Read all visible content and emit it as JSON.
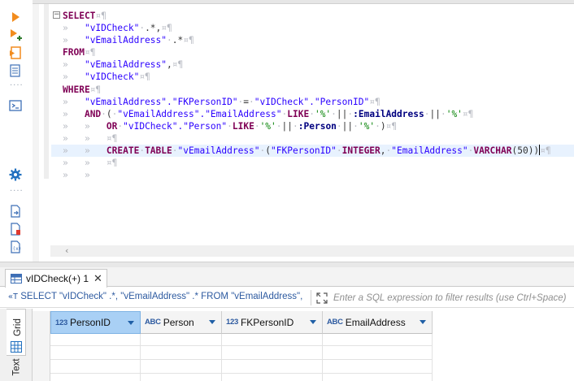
{
  "toolbar": {
    "icons": [
      "execute-statement-icon",
      "execute-in-new-tab-icon",
      "execute-script-icon",
      "explain-plan-icon",
      "open-console-icon",
      "settings-icon",
      "export-icon",
      "import-icon",
      "load-parameters-icon"
    ]
  },
  "editor": {
    "lines": [
      [
        {
          "c": "kw",
          "t": "SELECT"
        },
        {
          "c": "ws",
          "t": "¤¶"
        }
      ],
      [
        {
          "c": "ws",
          "t": "»   "
        },
        {
          "c": "id",
          "t": "\"vIDCheck\""
        },
        {
          "c": "ws",
          "t": "·"
        },
        {
          "c": "pn",
          "t": ".*,"
        },
        {
          "c": "ws",
          "t": "¤¶"
        }
      ],
      [
        {
          "c": "ws",
          "t": "»   "
        },
        {
          "c": "id",
          "t": "\"vEmailAddress\""
        },
        {
          "c": "ws",
          "t": "·"
        },
        {
          "c": "pn",
          "t": ".*"
        },
        {
          "c": "ws",
          "t": "¤¶"
        }
      ],
      [
        {
          "c": "kw",
          "t": "FROM"
        },
        {
          "c": "ws",
          "t": "¤¶"
        }
      ],
      [
        {
          "c": "ws",
          "t": "»   "
        },
        {
          "c": "id",
          "t": "\"vEmailAddress\""
        },
        {
          "c": "pn",
          "t": ","
        },
        {
          "c": "ws",
          "t": "¤¶"
        }
      ],
      [
        {
          "c": "ws",
          "t": "»   "
        },
        {
          "c": "id",
          "t": "\"vIDCheck\""
        },
        {
          "c": "ws",
          "t": "¤¶"
        }
      ],
      [
        {
          "c": "kw",
          "t": "WHERE"
        },
        {
          "c": "ws",
          "t": "¤¶"
        }
      ],
      [
        {
          "c": "ws",
          "t": "»   "
        },
        {
          "c": "id",
          "t": "\"vEmailAddress\".\"FKPersonID\""
        },
        {
          "c": "ws",
          "t": "·"
        },
        {
          "c": "pn",
          "t": "="
        },
        {
          "c": "ws",
          "t": "·"
        },
        {
          "c": "id",
          "t": "\"vIDCheck\".\"PersonID\""
        },
        {
          "c": "ws",
          "t": "¤¶"
        }
      ],
      [
        {
          "c": "ws",
          "t": "»   "
        },
        {
          "c": "kw",
          "t": "AND"
        },
        {
          "c": "ws",
          "t": "·"
        },
        {
          "c": "pn",
          "t": "("
        },
        {
          "c": "ws",
          "t": "·"
        },
        {
          "c": "id",
          "t": "\"vEmailAddress\".\"EmailAddress\""
        },
        {
          "c": "ws",
          "t": "·"
        },
        {
          "c": "kw",
          "t": "LIKE"
        },
        {
          "c": "ws",
          "t": "·"
        },
        {
          "c": "str",
          "t": "'%'"
        },
        {
          "c": "ws",
          "t": "·"
        },
        {
          "c": "pn",
          "t": "||"
        },
        {
          "c": "ws",
          "t": "·"
        },
        {
          "c": "prm",
          "t": ":EmailAddress"
        },
        {
          "c": "ws",
          "t": "·"
        },
        {
          "c": "pn",
          "t": "||"
        },
        {
          "c": "ws",
          "t": "·"
        },
        {
          "c": "str",
          "t": "'%'"
        },
        {
          "c": "ws",
          "t": "¤¶"
        }
      ],
      [
        {
          "c": "ws",
          "t": "»   »   "
        },
        {
          "c": "kw",
          "t": "OR"
        },
        {
          "c": "ws",
          "t": "·"
        },
        {
          "c": "id",
          "t": "\"vIDCheck\".\"Person\""
        },
        {
          "c": "ws",
          "t": "·"
        },
        {
          "c": "kw",
          "t": "LIKE"
        },
        {
          "c": "ws",
          "t": "·"
        },
        {
          "c": "str",
          "t": "'%'"
        },
        {
          "c": "ws",
          "t": "·"
        },
        {
          "c": "pn",
          "t": "||"
        },
        {
          "c": "ws",
          "t": "·"
        },
        {
          "c": "prm",
          "t": ":Person"
        },
        {
          "c": "ws",
          "t": "·"
        },
        {
          "c": "pn",
          "t": "||"
        },
        {
          "c": "ws",
          "t": "·"
        },
        {
          "c": "str",
          "t": "'%'"
        },
        {
          "c": "ws",
          "t": "·"
        },
        {
          "c": "pn",
          "t": ")"
        },
        {
          "c": "ws",
          "t": "¤¶"
        }
      ],
      [
        {
          "c": "ws",
          "t": "»   »   ¤¶"
        }
      ],
      [
        {
          "c": "ws",
          "t": "»   »   "
        },
        {
          "c": "kw",
          "t": "CREATE"
        },
        {
          "c": "ws",
          "t": "·"
        },
        {
          "c": "kw",
          "t": "TABLE"
        },
        {
          "c": "ws",
          "t": "·"
        },
        {
          "c": "id",
          "t": "\"vEmailAddress\""
        },
        {
          "c": "ws",
          "t": "·"
        },
        {
          "c": "pn",
          "t": "("
        },
        {
          "c": "id",
          "t": "\"FKPersonID\""
        },
        {
          "c": "ws",
          "t": "·"
        },
        {
          "c": "kw",
          "t": "INTEGER"
        },
        {
          "c": "pn",
          "t": ","
        },
        {
          "c": "ws",
          "t": "·"
        },
        {
          "c": "id",
          "t": "\"EmailAddress\""
        },
        {
          "c": "ws",
          "t": "·"
        },
        {
          "c": "kw",
          "t": "VARCHAR"
        },
        {
          "c": "pn",
          "t": "(50))"
        },
        {
          "c": "caret",
          "t": ""
        },
        {
          "c": "ws",
          "t": "¤¶"
        }
      ],
      [
        {
          "c": "ws",
          "t": "»   »   ¤¶"
        }
      ],
      [
        {
          "c": "ws",
          "t": "»   »"
        }
      ]
    ]
  },
  "results": {
    "tab_label": "vIDCheck(+) 1",
    "tab_close": "✕",
    "filter_sql_icon": "«T",
    "filter_sql_text": "SELECT \"vIDCheck\" .*, \"vEmailAddress\" .* FROM \"vEmailAddress\",",
    "filter_placeholder": "Enter a SQL expression to filter results (use Ctrl+Space)",
    "vtab_grid": "Grid",
    "vtab_text": "Text",
    "columns": [
      {
        "type": "123",
        "name": "PersonID",
        "selected": true
      },
      {
        "type": "ABC",
        "name": "Person",
        "selected": false
      },
      {
        "type": "123",
        "name": "FKPersonID",
        "selected": false
      },
      {
        "type": "ABC",
        "name": "EmailAddress",
        "selected": false
      }
    ]
  },
  "colors": {
    "keyword": "#7f0055",
    "identifier": "#2a00ff",
    "string": "#008000",
    "parameter": "#000080",
    "whitespace_marker": "#b9bcc4",
    "selected_column": "#a9d0f5",
    "accent_orange": "#f28c1e",
    "accent_blue": "#1f5fa6"
  }
}
